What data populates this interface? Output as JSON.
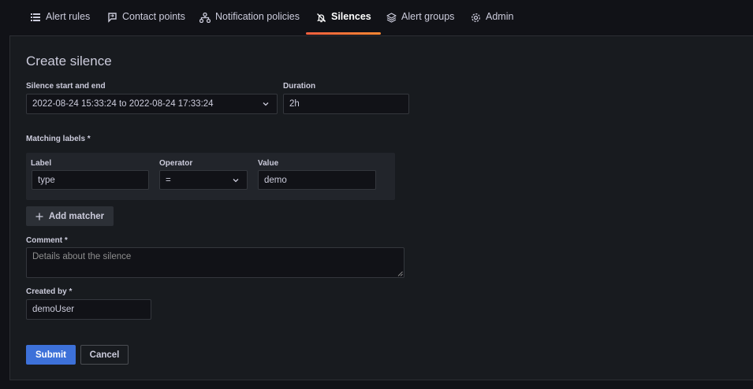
{
  "tabs": [
    {
      "label": "Alert rules",
      "icon": "list-icon"
    },
    {
      "label": "Contact points",
      "icon": "comment-arrow-icon"
    },
    {
      "label": "Notification policies",
      "icon": "sitemap-icon"
    },
    {
      "label": "Silences",
      "icon": "bell-slash-icon"
    },
    {
      "label": "Alert groups",
      "icon": "layers-icon"
    },
    {
      "label": "Admin",
      "icon": "cog-icon"
    }
  ],
  "active_tab": "Silences",
  "accent_color": "#f55f3e",
  "form": {
    "title": "Create silence",
    "range_label": "Silence start and end",
    "range_value": "2022-08-24 15:33:24 to 2022-08-24 17:33:24",
    "duration_label": "Duration",
    "duration_value": "2h",
    "matching_label": "Matching labels *",
    "matcher": {
      "label_header": "Label",
      "operator_header": "Operator",
      "value_header": "Value",
      "label_value": "type",
      "operator_value": "=",
      "value_value": "demo"
    },
    "add_matcher_label": "Add matcher",
    "comment_label": "Comment *",
    "comment_placeholder": "Details about the silence",
    "created_by_label": "Created by *",
    "created_by_value": "demoUser",
    "submit_label": "Submit",
    "cancel_label": "Cancel"
  }
}
